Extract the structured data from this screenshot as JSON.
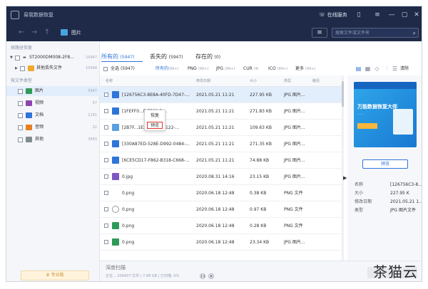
{
  "window": {
    "app_name": "易我数据恢复",
    "online_service": "在线服务",
    "location": "图片",
    "search_placeholder": "搜索文件或文件夹"
  },
  "icons": {
    "search": "search-icon",
    "back": "arrow-left-icon",
    "forward": "arrow-right-icon",
    "up": "arrow-up-icon",
    "menu": "hamburger-icon",
    "minimize": "minimize-icon",
    "maximize": "maximize-icon",
    "close": "close-icon"
  },
  "sidebar": {
    "section_path": "按路径恢复",
    "section_type": "按文件类型",
    "path_items": [
      {
        "label": "ST2000DM008-2F8...",
        "count": "10947"
      },
      {
        "label": "其他丢失文件",
        "count": "10048"
      }
    ],
    "type_items": [
      {
        "label": "图片",
        "count": "5947",
        "color": "#2f9a57"
      },
      {
        "label": "视频",
        "count": "57",
        "color": "#8e44ad"
      },
      {
        "label": "文档",
        "count": "1191",
        "color": "#2f74d8"
      },
      {
        "label": "音频",
        "count": "22",
        "color": "#e67e22"
      },
      {
        "label": "其他",
        "count": "3683",
        "color": "#7f8c8d"
      }
    ],
    "upgrade_label": "专业版"
  },
  "tabs": [
    {
      "label": "所有的",
      "count": "(5947)",
      "active": true
    },
    {
      "label": "丢失的",
      "count": "(5947)",
      "active": false
    },
    {
      "label": "存在的",
      "count": "(0)",
      "active": false
    }
  ],
  "filters": [
    {
      "label": "全选",
      "count": "(5947)",
      "active": false
    },
    {
      "label": "所有的",
      "count": "(99+)",
      "active": true
    },
    {
      "label": "PNG",
      "count": "(99+)",
      "active": false
    },
    {
      "label": "JPG",
      "count": "(99+)",
      "active": false
    },
    {
      "label": "CUR",
      "count": "(4)",
      "active": false
    },
    {
      "label": "ICO",
      "count": "(99+)",
      "active": false
    },
    {
      "label": "更多",
      "count": "(99+)",
      "active": false
    }
  ],
  "filter_reset": "清除",
  "columns": {
    "name": "名称",
    "date": "修改日期",
    "size": "大小",
    "type": "类型",
    "path": "路径"
  },
  "files": [
    {
      "name": "[126756C3-8E8A-40FD-7D47-...",
      "date": "2021.05.21 11:21",
      "size": "227.95 KB",
      "type": "JPG 图片...",
      "selected": true
    },
    {
      "name": "[1FEFF0...F-7F63-D...",
      "date": "2021.05.21 11:21",
      "size": "271.83 KB",
      "type": "JPG 图片...",
      "selected": false
    },
    {
      "name": "[2B7F...1E29-4588-2122-...",
      "date": "2021.05.21 11:21",
      "size": "109.63 KB",
      "type": "JPG 图片...",
      "selected": false
    },
    {
      "name": "[330A87ED-528E-D992-0484-...",
      "date": "2021.05.21 11:21",
      "size": "271.35 KB",
      "type": "JPG 图片...",
      "selected": false
    },
    {
      "name": "[6CE5CD17-F862-B318-C668-...",
      "date": "2021.05.21 11:21",
      "size": "74.88 KB",
      "type": "JPG 图片...",
      "selected": false
    },
    {
      "name": "0.jpg",
      "date": "2020.08.31 14:16",
      "size": "23.15 KB",
      "type": "JPG 图片...",
      "selected": false
    },
    {
      "name": "0.png",
      "date": "2020.06.18 12:48",
      "size": "0.38 KB",
      "type": "PNG 文件",
      "selected": false
    },
    {
      "name": "0.png",
      "date": "2020.06.18 12:48",
      "size": "0.97 KB",
      "type": "PNG 文件",
      "selected": false
    },
    {
      "name": "0.png",
      "date": "2020.06.18 12:48",
      "size": "0.28 KB",
      "type": "PNG 文件",
      "selected": false
    },
    {
      "name": "0.png",
      "date": "2020.06.18 12:48",
      "size": "23.34 KB",
      "type": "JPG 图片...",
      "selected": false
    }
  ],
  "context_menu": {
    "recover": "恢复",
    "preview": "预览"
  },
  "preview": {
    "title": "万能数据恢复大师",
    "subtitle": "......",
    "button": "预览",
    "meta": [
      {
        "key": "名称",
        "value": "[126756C3-8..."
      },
      {
        "key": "大小",
        "value": "227.95 K"
      },
      {
        "key": "修改日期",
        "value": "2021.05.21 1..."
      },
      {
        "key": "类型",
        "value": "JPG 图片文件"
      }
    ]
  },
  "bottom": {
    "scan_title": "深度扫描",
    "scan_status": "正在... 10940个文件 | 7.68 GB | 已扫描: 0%"
  },
  "watermark": "茶猫云"
}
